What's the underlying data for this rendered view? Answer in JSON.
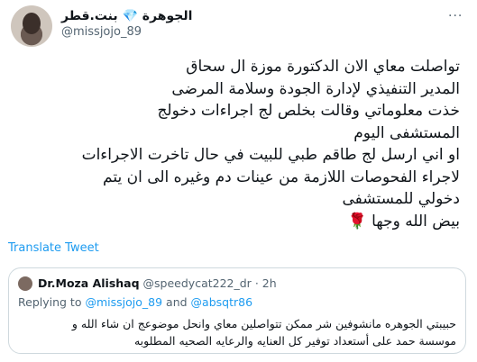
{
  "tweet": {
    "display_name": "الجوهرة 💎 بنت.قطر",
    "handle": "@missjojo_89",
    "more_label": "···",
    "body_lines": [
      "تواصلت معاي الان الدكتورة موزة ال سحاق",
      "المدير التنفيذي لإدارة الجودة وسلامة المرضى",
      "خذت معلوماتي وقالت بخلص لج اجراءات دخولج",
      "المستشفى اليوم",
      "او اني ارسل لج طاقم طبي للبيت في حال تاخرت الاجراءات",
      "لاجراء الفحوصات اللازمة من عينات دم وغيره الى ان يتم",
      "دخولي للمستشفى",
      "بيض الله وجها"
    ],
    "rose_emoji": "🌹",
    "translate_label": "Translate Tweet"
  },
  "quote": {
    "name": "Dr.Moza Alishaq",
    "handle": "@speedycat222_dr",
    "separator": "·",
    "time": "2h",
    "replying_prefix": "Replying to",
    "replying_to_1": "@missjojo_89",
    "replying_and": "and",
    "replying_to_2": "@absqtr86",
    "text_lines": [
      "حبيبتي الجوهره مانشوفين شر ممكن تتواصلين معاي وانحل موضوعج ان شاء الله و",
      "موسسة حمد على أستعداد توفير كل العنايه والرعايه الصحيه المطلوبه"
    ]
  }
}
